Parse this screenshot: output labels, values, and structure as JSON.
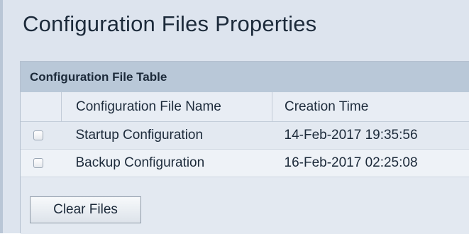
{
  "page": {
    "title": "Configuration Files Properties"
  },
  "table": {
    "caption": "Configuration File Table",
    "columns": [
      "",
      "Configuration File Name",
      "Creation Time"
    ],
    "rows": [
      {
        "checked": false,
        "name": "Startup Configuration",
        "creation_time": "14-Feb-2017 19:35:56"
      },
      {
        "checked": false,
        "name": "Backup Configuration",
        "creation_time": "16-Feb-2017 02:25:08"
      }
    ]
  },
  "actions": {
    "clear_files_label": "Clear Files"
  },
  "colors": {
    "panel_header_bg": "#b9c8d8",
    "page_bg": "#dde4ee"
  }
}
